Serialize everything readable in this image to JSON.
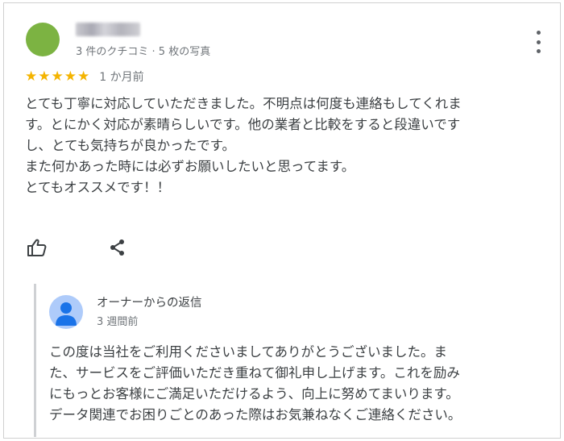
{
  "review": {
    "author_avatar_color": "#7cb342",
    "meta": "3 件のクチコミ · 5 枚の写真",
    "rating": 5,
    "stars": [
      "★",
      "★",
      "★",
      "★",
      "★"
    ],
    "time": "1 か月前",
    "text": "とても丁寧に対応していただきました。不明点は何度も連絡もしてくれま\nす。とにかく対応が素晴らしいです。他の業者と比較をすると段違いです\nし、とても気持ちが良かったです。\nまた何かあった時には必ずお願いしたいと思ってます。\nとてもオススメです！！"
  },
  "icons": {
    "more": "more-vert-icon",
    "like": "thumb-up-icon",
    "share": "share-icon",
    "owner": "person-icon"
  },
  "reply": {
    "label": "オーナーからの返信",
    "time": "3 週間前",
    "text": "この度は当社をご利用くださいましてありがとうございました。ま\nた、サービスをご評価いただき重ねて御礼申し上げます。これを励み\nにもっとお客様にご満足いただけるよう、向上に努めてまいります。\nデータ関連でお困りごとのあった際はお気兼ねなくご連絡ください。"
  }
}
